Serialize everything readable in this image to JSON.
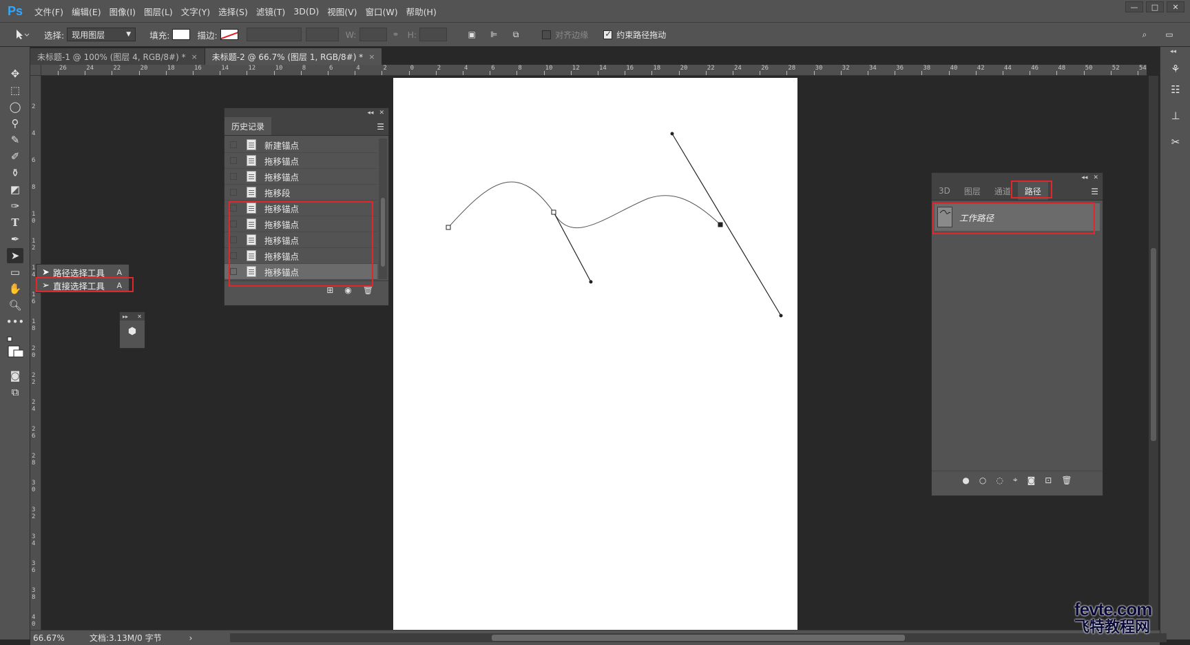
{
  "app": {
    "logo": "Ps"
  },
  "menu": [
    "文件(F)",
    "编辑(E)",
    "图像(I)",
    "图层(L)",
    "文字(Y)",
    "选择(S)",
    "滤镜(T)",
    "3D(D)",
    "视图(V)",
    "窗口(W)",
    "帮助(H)"
  ],
  "window_controls": {
    "minimize": "—",
    "maximize": "□",
    "close": "✕"
  },
  "options": {
    "select_label": "选择:",
    "select_value": "现用图层",
    "fill_label": "填充:",
    "stroke_label": "描边:",
    "w_label": "W:",
    "h_label": "H:",
    "align_edges": "对齐边缘",
    "constrain_path": "约束路径拖动"
  },
  "doc_tabs": [
    {
      "label": "未标题-1 @ 100% (图层 4, RGB/8#) *",
      "close": "×"
    },
    {
      "label": "未标题-2 @ 66.7% (图层 1, RGB/8#) *",
      "close": "×"
    }
  ],
  "ruler": {
    "top": [
      "26",
      "24",
      "22",
      "20",
      "18",
      "16",
      "14",
      "12",
      "10",
      "8",
      "6",
      "4",
      "2",
      "0",
      "2",
      "4",
      "6",
      "8",
      "10",
      "12",
      "14",
      "16",
      "18",
      "20",
      "22",
      "24",
      "26",
      "28",
      "30",
      "32",
      "34",
      "36",
      "38",
      "40",
      "42",
      "44",
      "46",
      "48",
      "50",
      "52",
      "54",
      "56"
    ],
    "left": [
      "2",
      "4",
      "6",
      "8",
      "1\n0",
      "1\n2",
      "1\n4",
      "1\n6",
      "1\n8",
      "2\n0",
      "2\n2",
      "2\n4",
      "2\n6",
      "2\n8",
      "3\n0",
      "3\n2",
      "3\n4",
      "3\n6",
      "3\n8",
      "4\n0",
      "4\n2"
    ]
  },
  "history": {
    "tab": "历史记录",
    "items": [
      "新建锚点",
      "拖移锚点",
      "拖移锚点",
      "拖移段",
      "拖移锚点",
      "拖移锚点",
      "拖移锚点",
      "拖移锚点",
      "拖移锚点"
    ],
    "selected_index": 8
  },
  "flyout": {
    "items": [
      {
        "label": "路径选择工具",
        "key": "A"
      },
      {
        "label": "直接选择工具",
        "key": "A"
      }
    ]
  },
  "paths_panel": {
    "tabs": [
      "3D",
      "图层",
      "通道",
      "路径"
    ],
    "active_tab": "路径",
    "path_name": "工作路径"
  },
  "status": {
    "zoom": "66.67%",
    "doc_info": "文档:3.13M/0 字节"
  },
  "watermark": {
    "top": "fevte.com",
    "bottom": "飞特教程网"
  },
  "colors": {
    "highlight": "#e2262b",
    "panel": "#535353",
    "canvas": "#282828"
  }
}
